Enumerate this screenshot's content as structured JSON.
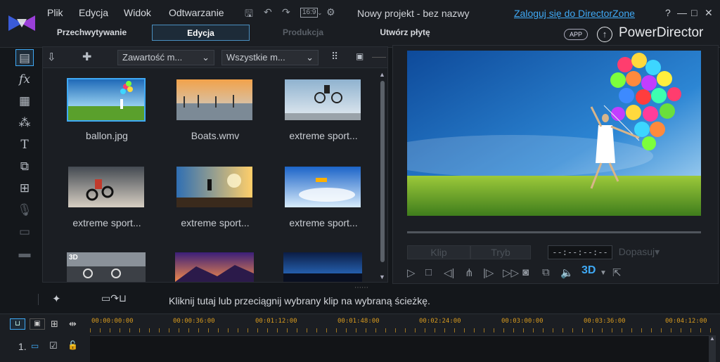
{
  "menu": [
    "Plik",
    "Edycja",
    "Widok",
    "Odtwarzanie"
  ],
  "aspect": "16:9",
  "window_title": "Nowy projekt - bez nazwy",
  "login_link": "Zaloguj się do DirectorZone",
  "window_buttons": [
    "?",
    "—",
    "□",
    "✕"
  ],
  "mode_tabs": [
    "Przechwytywanie",
    "Edycja",
    "Produkcja",
    "Utwórz płytę"
  ],
  "app_badge": "APP",
  "brand": "PowerDirector",
  "library": {
    "dropdown_content": "Zawartość m...",
    "dropdown_filter": "Wszystkie m...",
    "items": [
      {
        "label": "ballon.jpg"
      },
      {
        "label": "Boats.wmv"
      },
      {
        "label": "extreme sport..."
      },
      {
        "label": "extreme sport..."
      },
      {
        "label": "extreme sport..."
      },
      {
        "label": "extreme sport..."
      },
      {
        "label": ""
      },
      {
        "label": ""
      },
      {
        "label": ""
      }
    ],
    "third_row_badge": "3D"
  },
  "preview": {
    "clip_label": "Klip",
    "mode_label": "Tryb",
    "timecode": "--:--:--:--",
    "fit_label": "Dopasuj",
    "badge_3d": "3D"
  },
  "hint_text": "Kliknij tutaj lub przeciągnij wybrany klip na wybraną ścieżkę.",
  "timeline": {
    "ticks": [
      "00:00:00:00",
      "00:00:36:00",
      "00:01:12:00",
      "00:01:48:00",
      "00:02:24:00",
      "00:03:00:00",
      "00:03:36:00",
      "00:04:12:00"
    ],
    "track_number": "1."
  },
  "colors": {
    "accent": "#3fa9f5",
    "tick": "#d89b1f"
  }
}
